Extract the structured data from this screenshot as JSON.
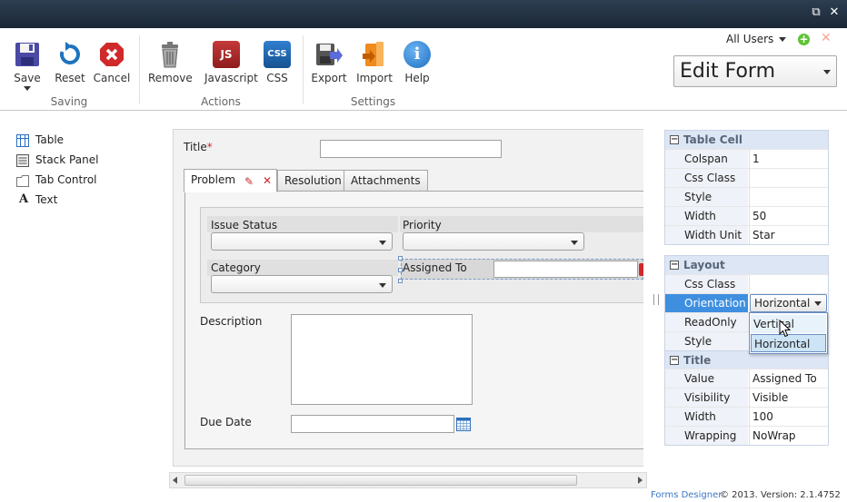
{
  "window": {
    "restore_glyph": "⧉",
    "close_glyph": "✕"
  },
  "ribbon": {
    "buttons": {
      "save": "Save",
      "reset": "Reset",
      "cancel": "Cancel",
      "remove": "Remove",
      "javascript": "Javascript",
      "css": "CSS",
      "export": "Export",
      "import": "Import",
      "help": "Help"
    },
    "icon_text": {
      "javascript": "JS",
      "css": "CSS",
      "help": "i"
    },
    "groups": {
      "saving": "Saving",
      "actions": "Actions",
      "settings": "Settings"
    },
    "users_select": "All Users",
    "form_select": "Edit Form"
  },
  "toolbox": {
    "items": [
      {
        "label": "Table",
        "icon": "table-icon"
      },
      {
        "label": "Stack Panel",
        "icon": "stack-panel-icon"
      },
      {
        "label": "Tab Control",
        "icon": "tab-control-icon"
      },
      {
        "label": "Text",
        "icon": "text-icon",
        "glyph": "A"
      }
    ]
  },
  "form": {
    "title_label": "Title",
    "required_mark": "*",
    "tabs": [
      "Problem",
      "Resolution",
      "Attachments"
    ],
    "fields": {
      "issue_status": "Issue Status",
      "priority": "Priority",
      "category": "Category",
      "assigned_to": "Assigned To",
      "description": "Description",
      "due_date": "Due Date"
    }
  },
  "properties": {
    "table_cell": {
      "header": "Table Cell",
      "rows": [
        {
          "key": "Colspan",
          "value": "1"
        },
        {
          "key": "Css Class",
          "value": ""
        },
        {
          "key": "Style",
          "value": ""
        },
        {
          "key": "Width",
          "value": "50"
        },
        {
          "key": "Width Unit",
          "value": "Star"
        }
      ]
    },
    "layout": {
      "header": "Layout",
      "rows": [
        {
          "key": "Css Class",
          "value": ""
        },
        {
          "key": "Orientation",
          "value": "Horizontal"
        },
        {
          "key": "ReadOnly",
          "value": ""
        },
        {
          "key": "Style",
          "value": ""
        }
      ],
      "orientation_options": [
        "Vertical",
        "Horizontal"
      ]
    },
    "title": {
      "header": "Title",
      "rows": [
        {
          "key": "Value",
          "value": "Assigned To"
        },
        {
          "key": "Visibility",
          "value": "Visible"
        },
        {
          "key": "Width",
          "value": "100"
        },
        {
          "key": "Wrapping",
          "value": "NoWrap"
        }
      ]
    },
    "collapse_glyph": "−"
  },
  "footer": {
    "product": "Forms Designer",
    "version": "© 2013. Version: 2.1.4752"
  },
  "colors": {
    "titlebar": "#1f2d3c",
    "accent_blue": "#1e73be",
    "danger_red": "#d0292b",
    "prop_header": "#dce6f4",
    "highlight_row": "#3f8fe0"
  }
}
